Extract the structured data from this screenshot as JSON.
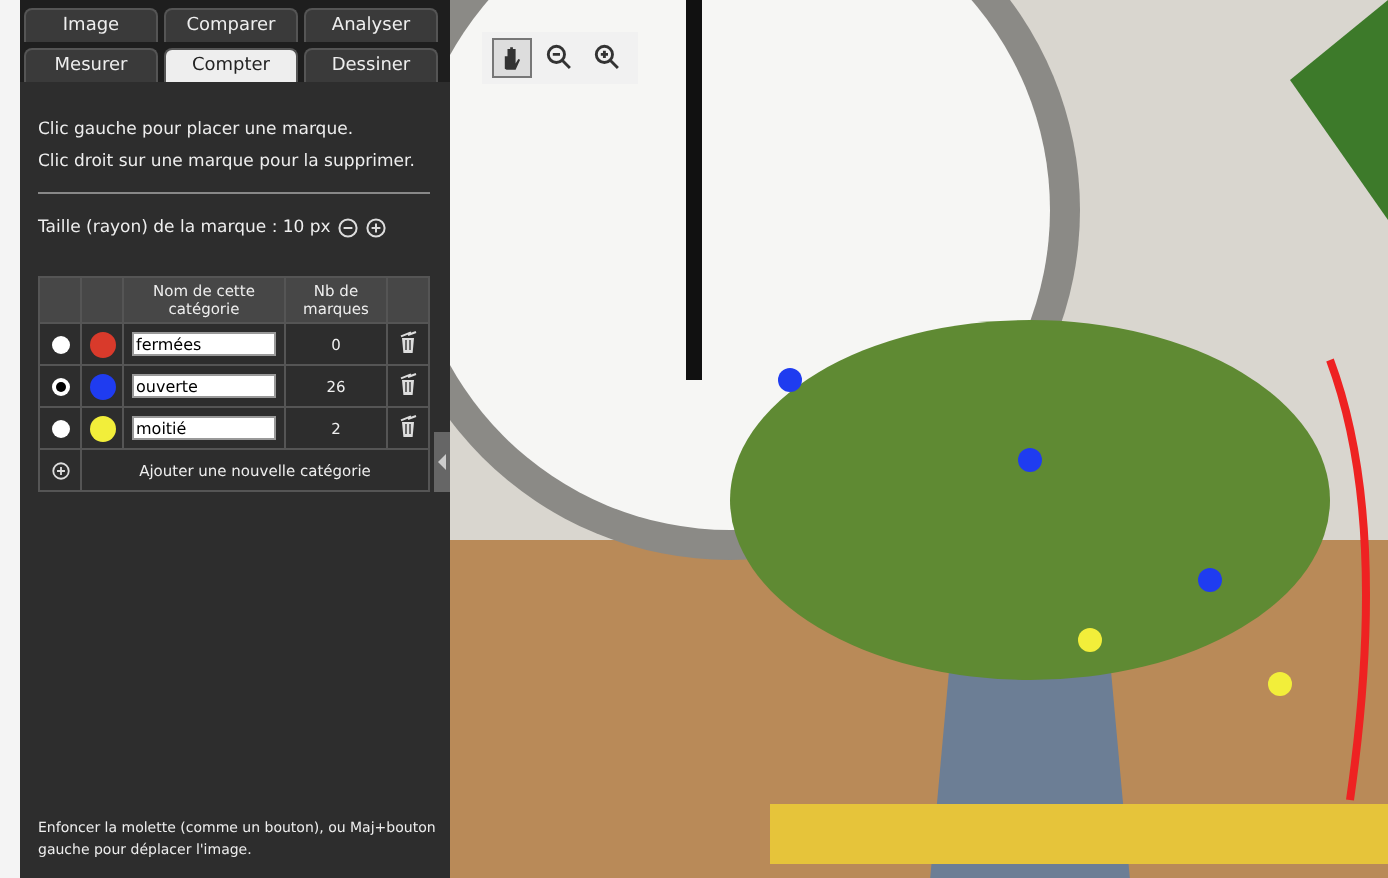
{
  "tabs": [
    {
      "label": "Image",
      "selected": false
    },
    {
      "label": "Comparer",
      "selected": false
    },
    {
      "label": "Analyser",
      "selected": false
    },
    {
      "label": "Mesurer",
      "selected": false
    },
    {
      "label": "Compter",
      "selected": true
    },
    {
      "label": "Dessiner",
      "selected": false
    }
  ],
  "instructions": [
    "Clic gauche pour placer une marque.",
    "Clic droit sur une marque pour la supprimer."
  ],
  "marker_size": {
    "label": "Taille (rayon) de la marque : 10 px"
  },
  "table": {
    "columns": [
      "Nom de cette catégorie",
      "Nb de marques"
    ],
    "rows": [
      {
        "selected": false,
        "color": "#d93a2b",
        "name": "fermées",
        "count": "0"
      },
      {
        "selected": true,
        "color": "#1f3cf0",
        "name": "ouverte",
        "count": "26"
      },
      {
        "selected": false,
        "color": "#f2ee3a",
        "name": "moitié",
        "count": "2"
      }
    ],
    "add_label": "Ajouter une nouvelle catégorie"
  },
  "footer": "Enfoncer la molette (comme un bouton), ou Maj+bouton gauche pour déplacer l'image.",
  "toolbar": [
    {
      "kind": "pan",
      "selected": true
    },
    {
      "kind": "zoom-out",
      "selected": false
    },
    {
      "kind": "zoom-in",
      "selected": false
    }
  ],
  "photo": {
    "kind": "picture"
  }
}
